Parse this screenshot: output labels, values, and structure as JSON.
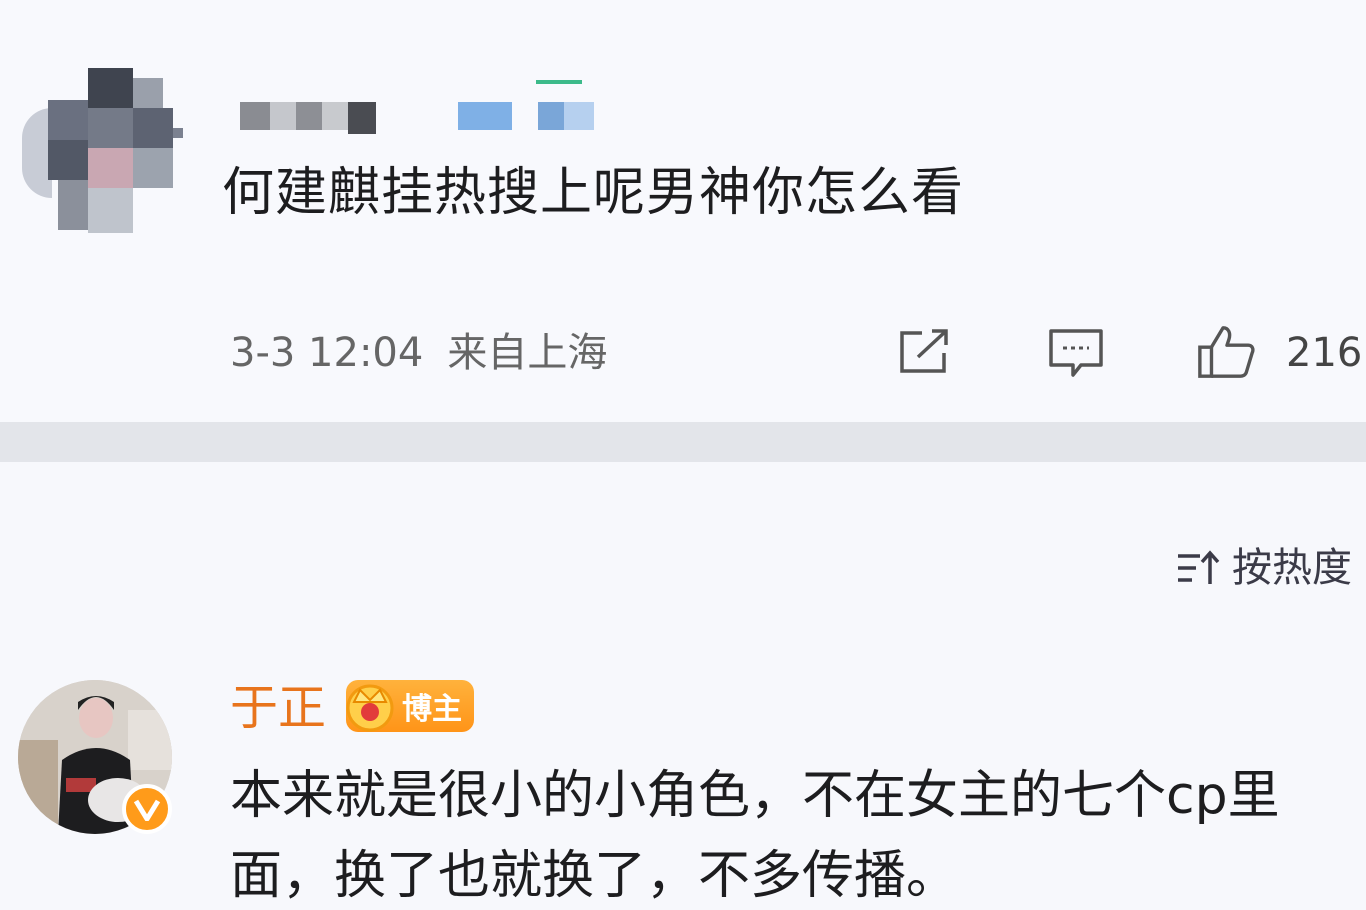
{
  "post": {
    "text": "何建麒挂热搜上呢男神你怎么看",
    "date": "3-3 12:04",
    "location": "来自上海",
    "icons": [
      "share-icon",
      "comment-icon",
      "like-icon"
    ],
    "like_count": "216"
  },
  "sort": {
    "icon": "sort-icon",
    "label": "按热度"
  },
  "comment": {
    "author": "于正",
    "badge": "博主",
    "text": "本来就是很小的小角色，不在女主的七个cp里面，换了也就换了，不多传播。"
  },
  "colors": {
    "accent_name": "#e8741c",
    "badge": "#ff9b1a",
    "background": "#f7f8fc",
    "divider": "#e3e5ea"
  }
}
